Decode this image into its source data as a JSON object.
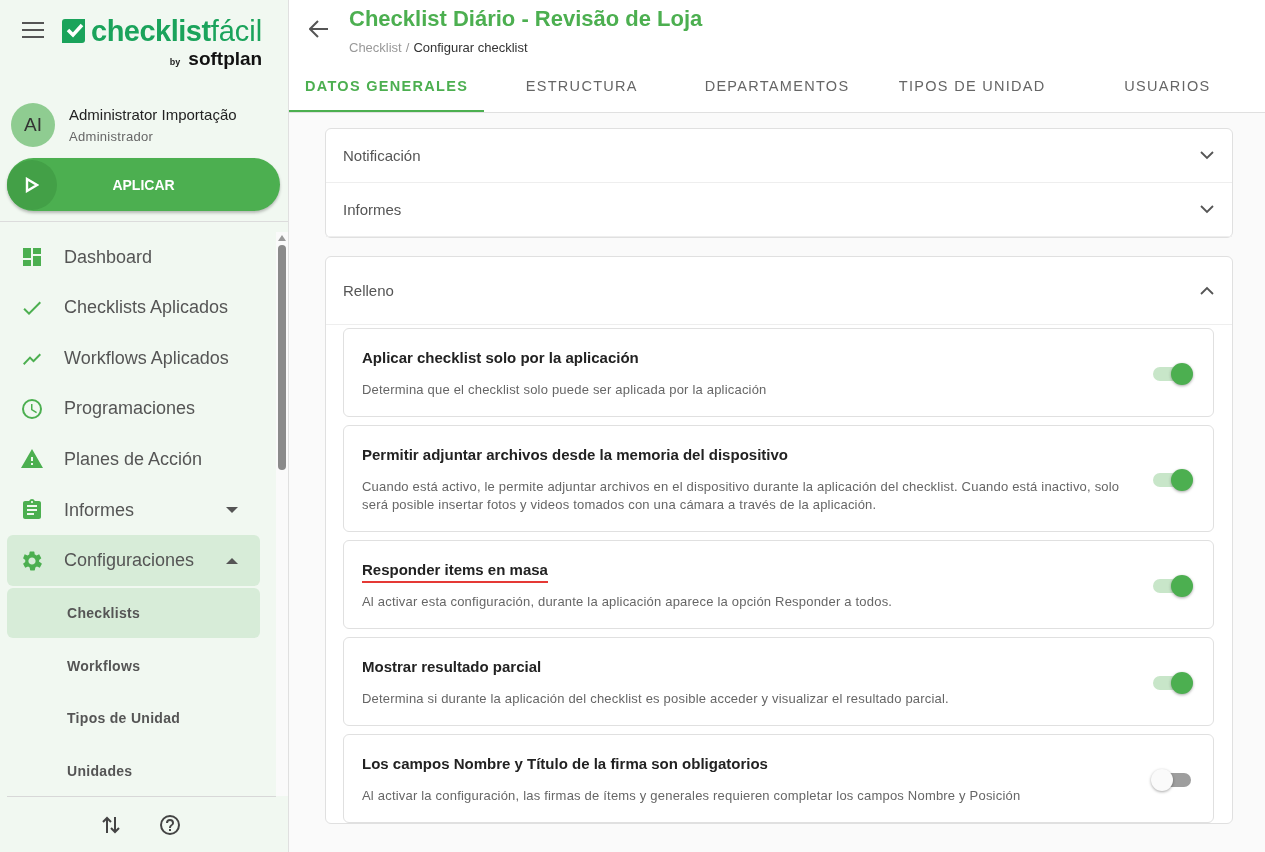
{
  "sidebar": {
    "logo": {
      "brand_main": "checklist",
      "brand_accent": "fácil",
      "by": "by",
      "partner": "softplan"
    },
    "user": {
      "initials": "AI",
      "name": "Administrator Importação",
      "role": "Administrador"
    },
    "apply_button": "APLICAR",
    "nav": [
      {
        "label": "Dashboard",
        "kind": "dashboard",
        "selected": false
      },
      {
        "label": "Checklists Aplicados",
        "kind": "check",
        "selected": false
      },
      {
        "label": "Workflows Aplicados",
        "kind": "trend",
        "selected": false
      },
      {
        "label": "Programaciones",
        "kind": "clock",
        "selected": false
      },
      {
        "label": "Planes de Acción",
        "kind": "warning",
        "selected": false
      },
      {
        "label": "Informes",
        "kind": "clipboard",
        "selected": false,
        "expanded": false
      },
      {
        "label": "Configuraciones",
        "kind": "gear",
        "selected": true,
        "expanded": true,
        "children": [
          {
            "label": "Checklists",
            "selected": true
          },
          {
            "label": "Workflows",
            "selected": false
          },
          {
            "label": "Tipos de Unidad",
            "selected": false
          },
          {
            "label": "Unidades",
            "selected": false
          }
        ]
      }
    ]
  },
  "header": {
    "title": "Checklist Diário - Revisão de Loja",
    "breadcrumb": [
      "Checklist",
      "Configurar checklist"
    ],
    "separator": "/"
  },
  "tabs": [
    {
      "label": "DATOS GENERALES",
      "selected": true
    },
    {
      "label": "ESTRUCTURA",
      "selected": false
    },
    {
      "label": "DEPARTAMENTOS",
      "selected": false
    },
    {
      "label": "TIPOS DE UNIDAD",
      "selected": false
    },
    {
      "label": "USUARIOS",
      "selected": false
    }
  ],
  "accordions": [
    {
      "panels": [
        {
          "title": "Notificación",
          "expanded": false
        },
        {
          "title": "Informes",
          "expanded": false
        }
      ]
    },
    {
      "panels": [
        {
          "title": "Relleno",
          "expanded": true,
          "settings": [
            {
              "title": "Aplicar checklist solo por la aplicación",
              "description": "Determina que el checklist solo puede ser aplicada por la aplicación",
              "on": true,
              "highlighted": false
            },
            {
              "title": "Permitir adjuntar archivos desde la memoria del dispositivo",
              "description": "Cuando está activo, le permite adjuntar archivos en el dispositivo durante la aplicación del checklist. Cuando está inactivo, solo será posible insertar fotos y videos tomados con una cámara a través de la aplicación.",
              "on": true,
              "highlighted": false
            },
            {
              "title": "Responder items en masa",
              "description": "Al activar esta configuración, durante la aplicación aparece la opción Responder a todos.",
              "on": true,
              "highlighted": true
            },
            {
              "title": "Mostrar resultado parcial",
              "description": "Determina si durante la aplicación del checklist es posible acceder y visualizar el resultado parcial.",
              "on": true,
              "highlighted": false
            },
            {
              "title": "Los campos Nombre y Título de la firma son obligatorios",
              "description": "Al activar la configuración, las firmas de ítems y generales requieren completar los campos Nombre y Posición",
              "on": false,
              "highlighted": false
            }
          ]
        }
      ]
    }
  ]
}
